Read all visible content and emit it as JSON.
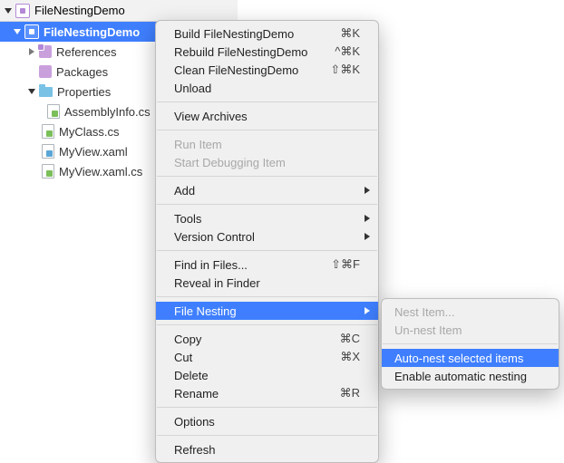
{
  "sidebar": {
    "solution_name": "FileNestingDemo",
    "project_name": "FileNestingDemo",
    "nodes": {
      "references": "References",
      "packages": "Packages",
      "properties": "Properties",
      "assemblyinfo": "AssemblyInfo.cs",
      "myclass": "MyClass.cs",
      "myview": "MyView.xaml",
      "myview_cs": "MyView.xaml.cs"
    }
  },
  "menu": {
    "build": "Build FileNestingDemo",
    "rebuild": "Rebuild FileNestingDemo",
    "clean": "Clean FileNestingDemo",
    "unload": "Unload",
    "view_archives": "View Archives",
    "run_item": "Run Item",
    "start_debugging": "Start Debugging Item",
    "add": "Add",
    "tools": "Tools",
    "version_control": "Version Control",
    "find_in_files": "Find in Files...",
    "reveal_in_finder": "Reveal in Finder",
    "file_nesting": "File Nesting",
    "copy": "Copy",
    "cut": "Cut",
    "delete": "Delete",
    "rename": "Rename",
    "options": "Options",
    "refresh": "Refresh",
    "sc_build": "⌘K",
    "sc_rebuild": "^⌘K",
    "sc_clean": "⇧⌘K",
    "sc_find": "⇧⌘F",
    "sc_copy": "⌘C",
    "sc_cut": "⌘X",
    "sc_rename": "⌘R"
  },
  "submenu": {
    "nest_item": "Nest Item...",
    "un_nest": "Un-nest Item",
    "auto_nest": "Auto-nest selected items",
    "enable_auto": "Enable automatic nesting"
  }
}
